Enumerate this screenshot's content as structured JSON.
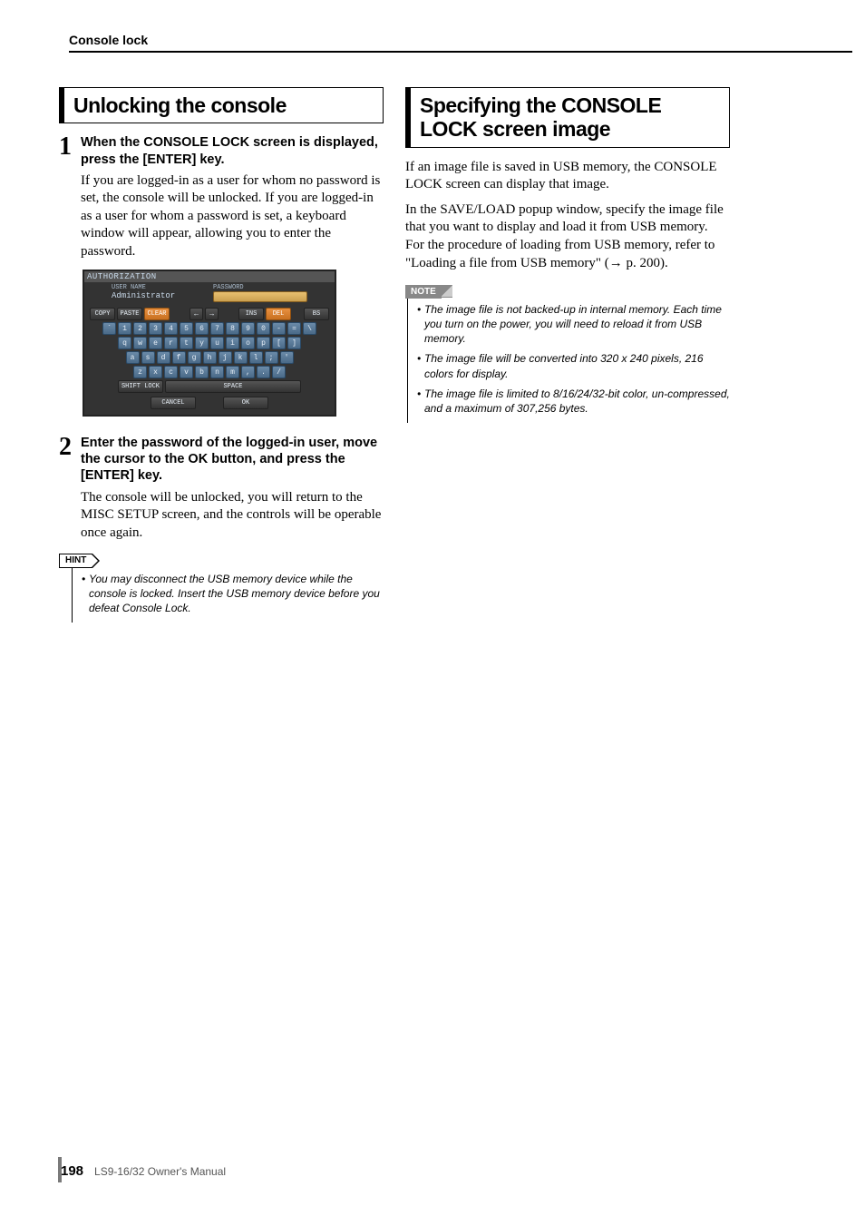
{
  "header": {
    "label": "Console lock"
  },
  "left": {
    "title": "Unlocking the console",
    "step1": {
      "num": "1",
      "head": "When the CONSOLE LOCK screen is displayed, press the [ENTER] key.",
      "text": "If you are logged-in as a user for whom no password is set, the console will be unlocked. If you are logged-in as a user for whom a password is set, a keyboard window will appear, allowing you to enter the password."
    },
    "keyboard": {
      "title": "AUTHORIZATION",
      "username_label": "USER NAME",
      "username_value": "Administrator",
      "password_label": "PASSWORD",
      "row_top": {
        "copy": "COPY",
        "paste": "PASTE",
        "clear": "CLEAR",
        "left": "←",
        "right": "→",
        "ins": "INS",
        "del": "DEL",
        "bs": "BS"
      },
      "row1": [
        "`",
        "1",
        "2",
        "3",
        "4",
        "5",
        "6",
        "7",
        "8",
        "9",
        "0",
        "-",
        "=",
        "\\"
      ],
      "row2": [
        "q",
        "w",
        "e",
        "r",
        "t",
        "y",
        "u",
        "i",
        "o",
        "p",
        "[",
        "]"
      ],
      "row3": [
        "a",
        "s",
        "d",
        "f",
        "g",
        "h",
        "j",
        "k",
        "l",
        ";",
        "'"
      ],
      "row4": [
        "z",
        "x",
        "c",
        "v",
        "b",
        "n",
        "m",
        ",",
        ".",
        "/"
      ],
      "shift": "SHIFT LOCK",
      "space": "SPACE",
      "cancel": "CANCEL",
      "ok": "OK"
    },
    "step2": {
      "num": "2",
      "head": "Enter the password of the logged-in user, move the cursor to the OK button, and press the [ENTER] key.",
      "text": "The console will be unlocked, you will return to the MISC SETUP screen, and the controls will be operable once again."
    },
    "hint": {
      "label": "HINT",
      "items": [
        "You may disconnect the USB memory device while the console is locked. Insert the USB memory device before you defeat Console Lock."
      ]
    }
  },
  "right": {
    "title": "Specifying the CONSOLE LOCK screen image",
    "body_a": "If an image file is saved in USB memory, the CONSOLE LOCK screen can display that image.",
    "body_b": "In the SAVE/LOAD popup window, specify the image file that you want to display and load it from USB memory. For the procedure of loading from USB memory, refer to \"Loading a file from USB memory\" (",
    "body_b_arrow": "→",
    "body_b_tail": " p. 200).",
    "note": {
      "label": "NOTE",
      "items": [
        "The image file is not backed-up in internal memory. Each time you turn on the power, you will need to reload it from USB memory.",
        "The image file will be converted into 320 x 240 pixels, 216 colors for display.",
        "The image file is limited to 8/16/24/32-bit color, un-compressed, and a maximum of 307,256 bytes."
      ]
    }
  },
  "footer": {
    "page": "198",
    "label": "LS9-16/32  Owner's Manual"
  }
}
